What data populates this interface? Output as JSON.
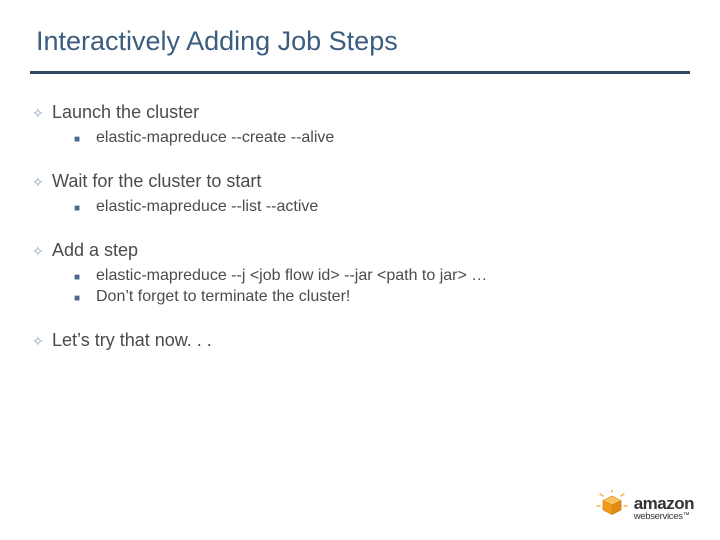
{
  "title": "Interactively Adding Job Steps",
  "bullets": [
    {
      "text": "Launch the cluster",
      "sub": [
        "elastic-mapreduce --create --alive"
      ]
    },
    {
      "text": "Wait for the cluster to start",
      "sub": [
        "elastic-mapreduce --list --active"
      ]
    },
    {
      "text": "Add a step",
      "sub": [
        "elastic-mapreduce --j <job flow id> --jar <path to jar> …",
        "Don’t forget to terminate the cluster!"
      ]
    },
    {
      "text": "Let’s try that now. . .",
      "sub": []
    }
  ],
  "logo": {
    "amazon": "amazon",
    "webservices": "webservices",
    "tm": "™"
  }
}
